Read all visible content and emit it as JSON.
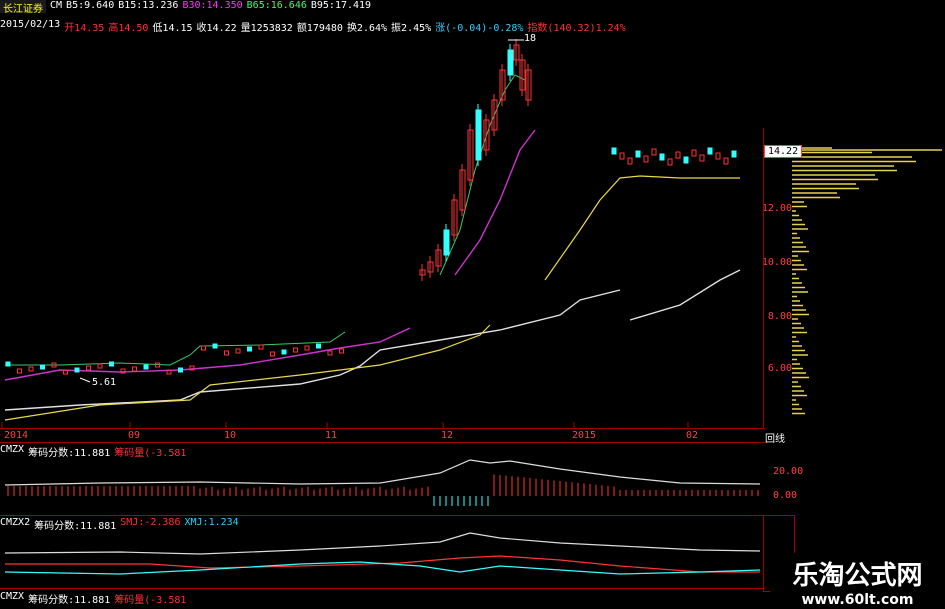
{
  "header": {
    "broker": "长江证券",
    "ma_line": [
      {
        "label": "CM",
        "cls": "white"
      },
      {
        "label": "B5:9.640",
        "cls": "white"
      },
      {
        "label": "B15:13.236",
        "cls": "white"
      },
      {
        "label": "B30:14.350",
        "cls": "magenta"
      },
      {
        "label": "B65:16.646",
        "cls": "green"
      },
      {
        "label": "B95:17.419",
        "cls": "white"
      }
    ],
    "quote_line": [
      {
        "label": "2015/02/13",
        "cls": "white"
      },
      {
        "label": "开14.35",
        "cls": "red"
      },
      {
        "label": "高14.50",
        "cls": "red"
      },
      {
        "label": "低14.15",
        "cls": "white"
      },
      {
        "label": "收14.22",
        "cls": "white"
      },
      {
        "label": "量1253832",
        "cls": "white"
      },
      {
        "label": "额179480",
        "cls": "white"
      },
      {
        "label": "换2.64%",
        "cls": "white"
      },
      {
        "label": "振2.45%",
        "cls": "white"
      },
      {
        "label": "涨(-0.04)-0.28%",
        "cls": "cyan"
      },
      {
        "label": "指数(140.32)1.24%",
        "cls": "red"
      }
    ]
  },
  "main_chart": {
    "price_axis": [
      "12.00",
      "10.00",
      "8.00",
      "6.00"
    ],
    "current_price": "14.22",
    "peak_label": "18",
    "low_label": "5.61",
    "time_axis": [
      "2014",
      "09",
      "10",
      "11",
      "12",
      "2015",
      "02"
    ],
    "panel_button": "回线"
  },
  "indicator1": {
    "title_parts": [
      {
        "label": "CMZX",
        "cls": "white"
      },
      {
        "label": "筹码分数:11.881",
        "cls": "white"
      },
      {
        "label": "筹码量(-3.581",
        "cls": "red"
      }
    ],
    "axis": [
      "20.00",
      "0.00"
    ]
  },
  "indicator2": {
    "title_parts": [
      {
        "label": "CMZX2",
        "cls": "white"
      },
      {
        "label": "筹码分数:11.881",
        "cls": "white"
      },
      {
        "label": "SMJ:-2.386",
        "cls": "red"
      },
      {
        "label": "XMJ:1.234",
        "cls": "cyan"
      }
    ]
  },
  "indicator3": {
    "title_parts": [
      {
        "label": "CMZX",
        "cls": "white"
      },
      {
        "label": "筹码分数:11.881",
        "cls": "white"
      },
      {
        "label": "筹码量(-3.581",
        "cls": "red"
      }
    ]
  },
  "watermark": {
    "title": "乐淘公式网",
    "url": "www.60lt.com"
  },
  "colors": {
    "axis_red": "#ff4040",
    "ma_yellow": "#e8d84a",
    "ma_magenta": "#cc33cc",
    "ma_white": "#e0e0e0",
    "candle_up": "#ff3333",
    "candle_down": "#33ffff",
    "profile_yellow": "#e6d34a"
  }
}
